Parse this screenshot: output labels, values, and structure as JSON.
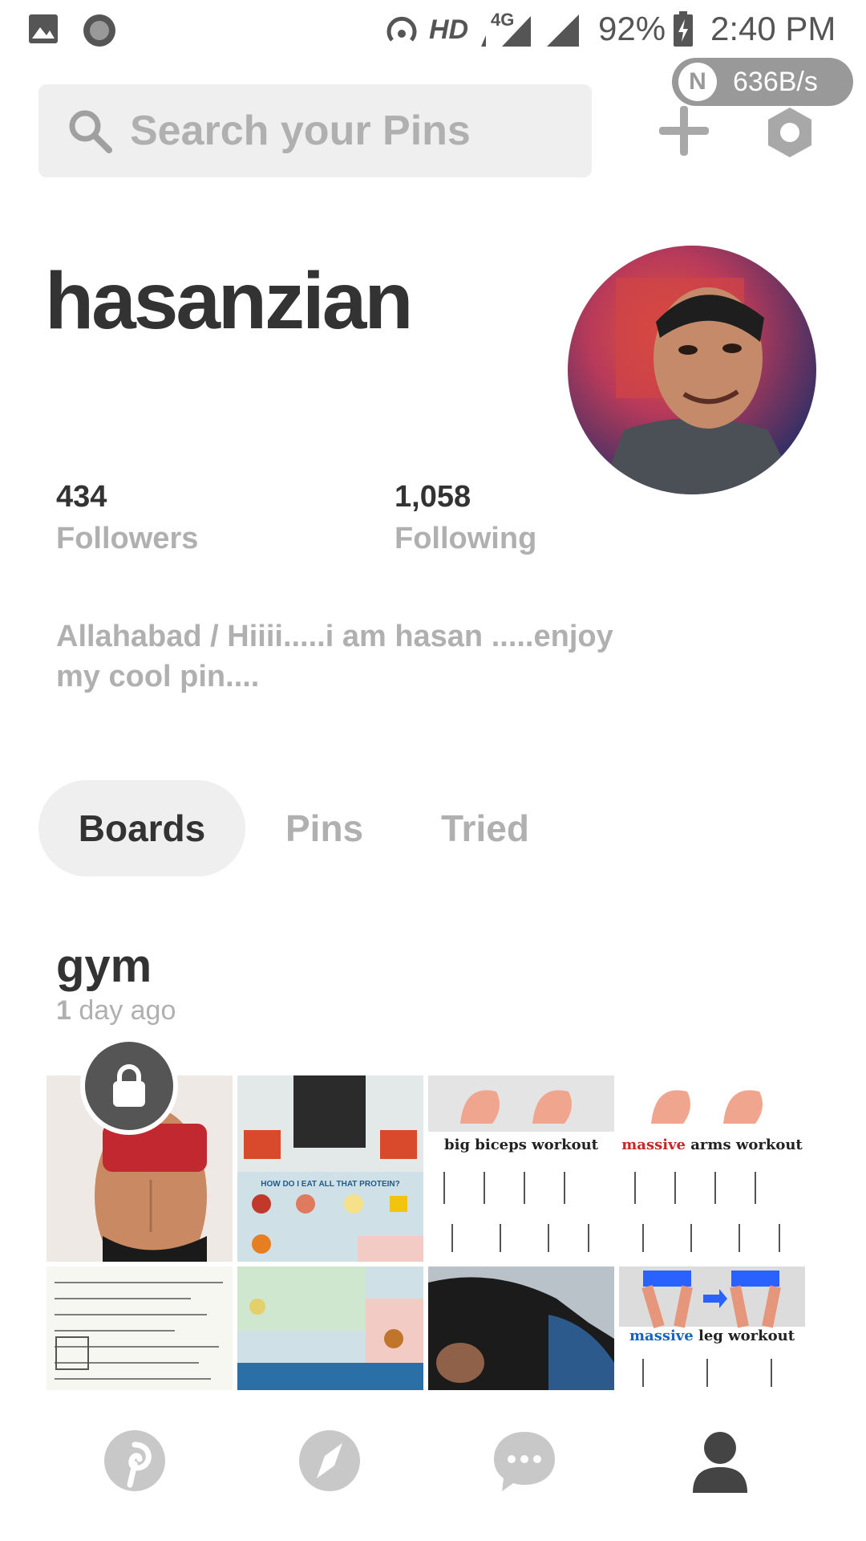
{
  "status_bar": {
    "network_type": "4G",
    "hd_label": "HD",
    "battery_percent": "92%",
    "time": "2:40 PM",
    "net_speed": "636B/s",
    "net_badge": "N"
  },
  "search": {
    "placeholder": "Search your Pins"
  },
  "profile": {
    "username": "hasanzian",
    "followers_count": "434",
    "followers_label": "Followers",
    "following_count": "1,058",
    "following_label": "Following",
    "bio_line1": "Allahabad / Hiiii.....i am hasan .....enjoy",
    "bio_line2": "my cool pin...."
  },
  "tabs": [
    {
      "label": "Boards",
      "active": true
    },
    {
      "label": "Pins",
      "active": false
    },
    {
      "label": "Tried",
      "active": false
    }
  ],
  "board": {
    "title": "gym",
    "updated_count": "1",
    "updated_suffix": "day ago",
    "private": true,
    "pins": [
      {
        "caption": ""
      },
      {
        "caption": "HOW DO I EAT ALL THAT PROTEIN?"
      },
      {
        "caption": "big biceps workout"
      },
      {
        "caption_accent": "massive",
        "caption": "arms workout"
      },
      {
        "caption": ""
      },
      {
        "caption": ""
      },
      {
        "caption": ""
      },
      {
        "caption_accent": "massive",
        "caption": "leg workout"
      }
    ]
  },
  "bottom_nav": [
    "home-icon",
    "explore-icon",
    "messages-icon",
    "profile-icon"
  ],
  "colors": {
    "text_dark": "#333333",
    "text_muted": "#b0b0b0",
    "surface": "#efefef",
    "icon_gray": "#c8c8c8",
    "accent_red": "#c62828",
    "accent_blue": "#1565c0"
  }
}
